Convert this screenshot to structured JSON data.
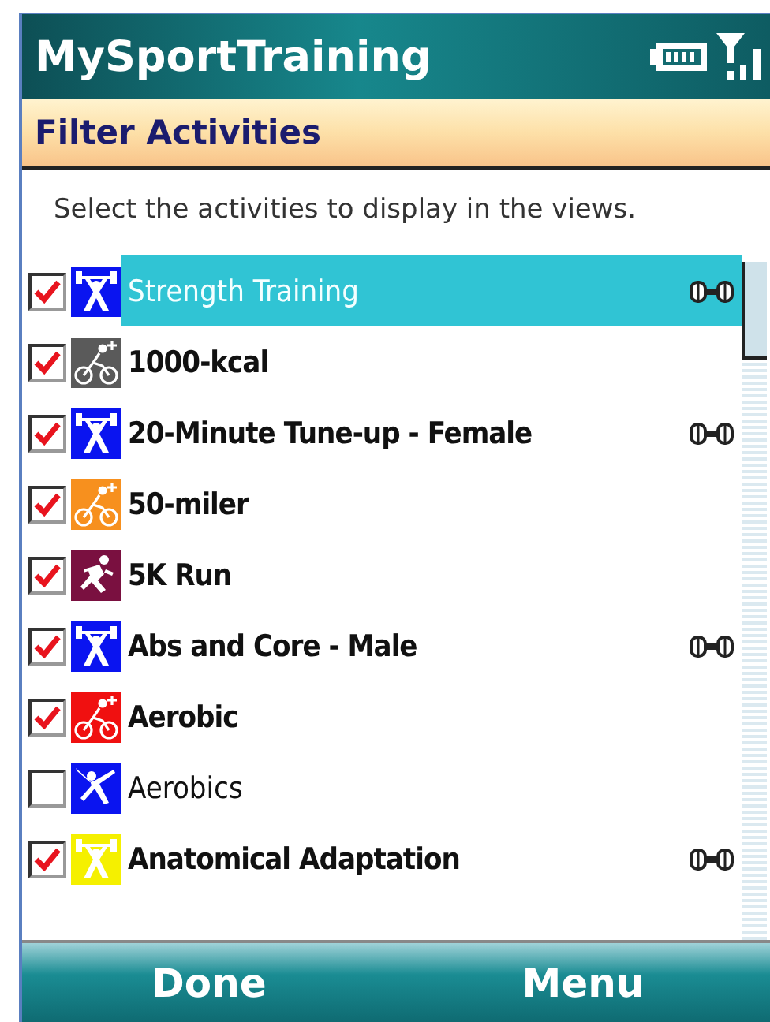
{
  "title_bar": {
    "title": "MySportTraining"
  },
  "header": {
    "title": "Filter Activities"
  },
  "instruction": "Select the activities to display in the views.",
  "activities": [
    {
      "name": "Strength Training",
      "checked": true,
      "selected": true,
      "kind": "weights",
      "color": "#0a14f0",
      "equipment": true
    },
    {
      "name": "1000-kcal",
      "checked": true,
      "selected": false,
      "kind": "bike",
      "color": "#5a5a5a",
      "equipment": false
    },
    {
      "name": "20-Minute Tune-up - Female",
      "checked": true,
      "selected": false,
      "kind": "weights",
      "color": "#0a14f0",
      "equipment": true
    },
    {
      "name": "50-miler",
      "checked": true,
      "selected": false,
      "kind": "bike",
      "color": "#f7901e",
      "equipment": false
    },
    {
      "name": "5K Run",
      "checked": true,
      "selected": false,
      "kind": "run",
      "color": "#7a1040",
      "equipment": false
    },
    {
      "name": "Abs and Core - Male",
      "checked": true,
      "selected": false,
      "kind": "weights",
      "color": "#0a14f0",
      "equipment": true
    },
    {
      "name": "Aerobic",
      "checked": true,
      "selected": false,
      "kind": "bike",
      "color": "#f01010",
      "equipment": false
    },
    {
      "name": "Aerobics",
      "checked": false,
      "selected": false,
      "kind": "aerobics",
      "color": "#0a14f0",
      "equipment": false
    },
    {
      "name": "Anatomical Adaptation",
      "checked": true,
      "selected": false,
      "kind": "weights",
      "color": "#f5f000",
      "equipment": true
    }
  ],
  "softkeys": [
    "Done",
    "Menu"
  ]
}
